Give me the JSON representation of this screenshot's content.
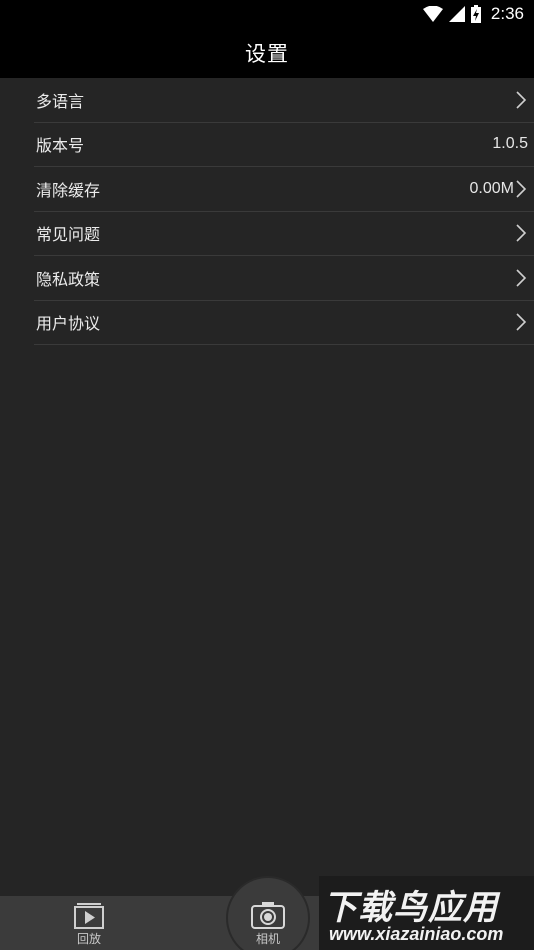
{
  "status_bar": {
    "time": "2:36"
  },
  "header": {
    "title": "设置"
  },
  "settings": {
    "items": [
      {
        "label": "多语言",
        "value": ""
      },
      {
        "label": "版本号",
        "value": "1.0.5"
      },
      {
        "label": "清除缓存",
        "value": "0.00M"
      },
      {
        "label": "常见问题",
        "value": ""
      },
      {
        "label": "隐私政策",
        "value": ""
      },
      {
        "label": "用户协议",
        "value": ""
      }
    ]
  },
  "bottom_nav": {
    "replay_label": "回放",
    "camera_label": "相机"
  },
  "watermark": {
    "title": "下载鸟应用",
    "url": "www.xiazainiao.com"
  }
}
